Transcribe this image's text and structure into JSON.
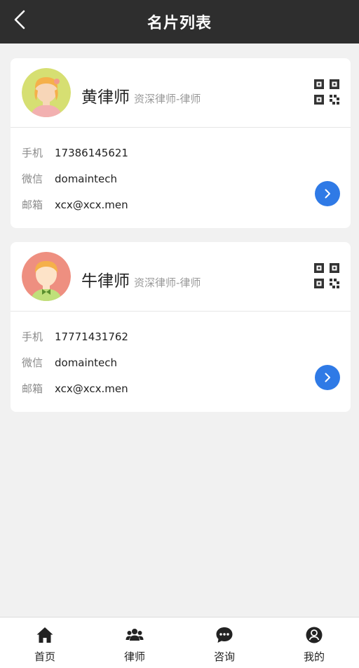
{
  "header": {
    "title": "名片列表"
  },
  "cards": [
    {
      "name": "黄律师",
      "title": "资深律师-律师",
      "rows": [
        {
          "label": "手机",
          "value": "17386145621"
        },
        {
          "label": "微信",
          "value": "domaintech"
        },
        {
          "label": "邮箱",
          "value": "xcx@xcx.men"
        }
      ]
    },
    {
      "name": "牛律师",
      "title": "资深律师-律师",
      "rows": [
        {
          "label": "手机",
          "value": "17771431762"
        },
        {
          "label": "微信",
          "value": "domaintech"
        },
        {
          "label": "邮箱",
          "value": "xcx@xcx.men"
        }
      ]
    }
  ],
  "tabbar": {
    "items": [
      {
        "label": "首页",
        "icon": "home-icon"
      },
      {
        "label": "律师",
        "icon": "users-icon"
      },
      {
        "label": "咨询",
        "icon": "chat-icon"
      },
      {
        "label": "我的",
        "icon": "user-circle-icon"
      }
    ]
  },
  "colors": {
    "header_bg": "#2e2e2e",
    "accent": "#2f7ae6",
    "page_bg": "#f1f1f1",
    "avatar1_bg": "#d6df72",
    "avatar2_bg": "#ee8f80"
  }
}
